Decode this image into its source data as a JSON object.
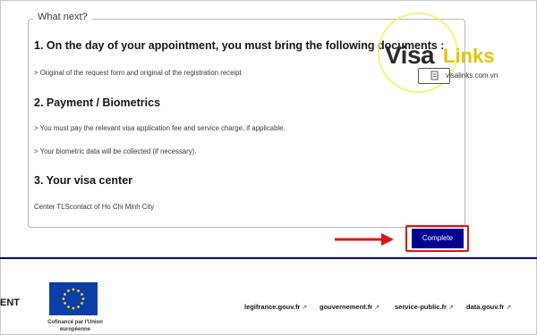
{
  "section": {
    "legend": "What next?",
    "heading1": "1. On the day of your appointment, you must bring the following documents :",
    "item1": "> Original of the request form and original of the registration receipt",
    "heading2": "2. Payment / Biometrics",
    "item2a": "> You must pay the relevant visa application fee and service charge, if applicable.",
    "item2b": "> Your biometric data will be collected (if necessary).",
    "heading3": "3. Your visa center",
    "item3": "Center TLScontact of Ho Chi Minh City"
  },
  "actions": {
    "complete_label": "Complete"
  },
  "footer": {
    "brand_fragment": "ENT",
    "eu_caption": "Cofinancé par l'Union européenne",
    "links": [
      "legifrance.gouv.fr",
      "gouvernement.fr",
      "service-public.fr",
      "data.gouv.fr"
    ]
  },
  "watermark": {
    "brand_part1": "Visa",
    "brand_part2": "Links",
    "url": "visalinks.com.vn"
  },
  "colors": {
    "button_bg": "#000091",
    "highlight": "#e11414",
    "footer_rule": "#000091",
    "eu_flag": "#0b3ea8",
    "eu_stars": "#ffdd00",
    "watermark_yellow": "#e6c300"
  },
  "icons": [
    "external-link-icon",
    "eu-flag-icon",
    "arrow-right-icon",
    "document-icon"
  ]
}
